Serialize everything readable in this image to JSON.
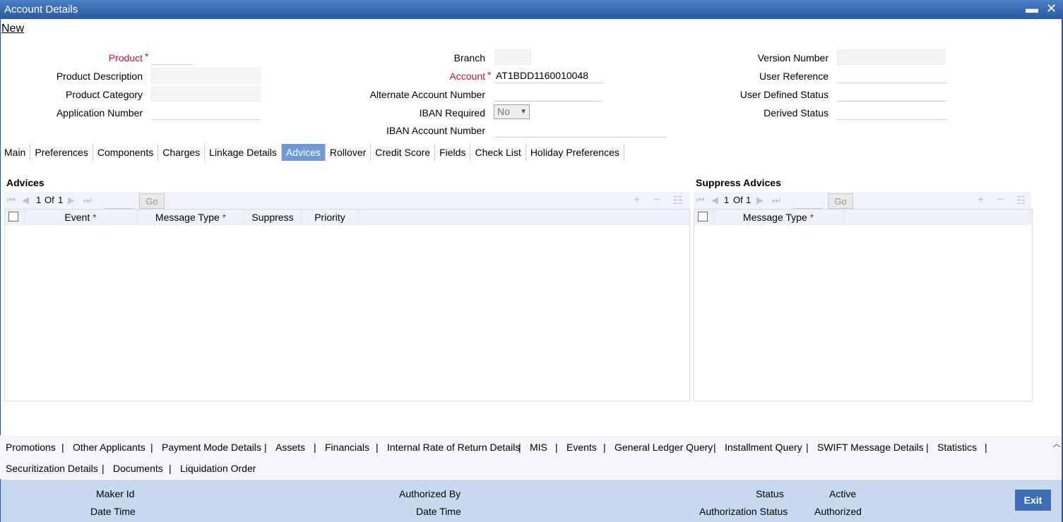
{
  "window": {
    "title": "Account Details",
    "minimize": "▬",
    "close": "✕"
  },
  "new_link": "New",
  "form": {
    "product_label": "Product",
    "product_description_label": "Product Description",
    "product_category_label": "Product Category",
    "application_number_label": "Application Number",
    "branch_label": "Branch",
    "account_label": "Account",
    "account_value": "AT1BDD1160010048",
    "alternate_account_label": "Alternate Account Number",
    "iban_required_label": "IBAN Required",
    "iban_required_value": "No",
    "iban_account_label": "IBAN Account Number",
    "version_number_label": "Version Number",
    "user_reference_label": "User Reference",
    "user_defined_status_label": "User Defined Status",
    "derived_status_label": "Derived Status",
    "required_mark": "*"
  },
  "tabs": [
    "Main",
    "Preferences",
    "Components",
    "Charges",
    "Linkage Details",
    "Advices",
    "Rollover",
    "Credit Score",
    "Fields",
    "Check List",
    "Holiday Preferences"
  ],
  "active_tab": "Advices",
  "advices": {
    "title": "Advices",
    "page_current": "1",
    "page_of": "Of",
    "page_total": "1",
    "go": "Go",
    "columns": {
      "event": "Event",
      "message_type": "Message Type",
      "suppress": "Suppress",
      "priority": "Priority"
    }
  },
  "suppress_advices": {
    "title": "Suppress Advices",
    "page_current": "1",
    "page_of": "Of",
    "page_total": "1",
    "go": "Go",
    "columns": {
      "message_type": "Message Type"
    }
  },
  "toolbar_icons": {
    "first": "⏮",
    "prev": "◀",
    "next": "▶",
    "last": "⏭",
    "add": "+",
    "delete": "−",
    "view": "☷"
  },
  "sub_links_row1": [
    "Promotions",
    "Other Applicants",
    "Payment Mode Details",
    "Assets",
    "Financials",
    "Internal Rate of Return Details",
    "MIS",
    "Events",
    "General Ledger Query",
    "Installment Query",
    "SWIFT Message Details",
    "Statistics"
  ],
  "sub_links_row2": [
    "Securitization Details",
    "Documents",
    "Liquidation Order"
  ],
  "pipe": "|",
  "footer": {
    "maker_id": "Maker Id",
    "date_time": "Date Time",
    "authorized_by": "Authorized By",
    "status_label": "Status",
    "status_value": "Active",
    "auth_status_label": "Authorization Status",
    "auth_status_value": "Authorized",
    "exit": "Exit"
  }
}
